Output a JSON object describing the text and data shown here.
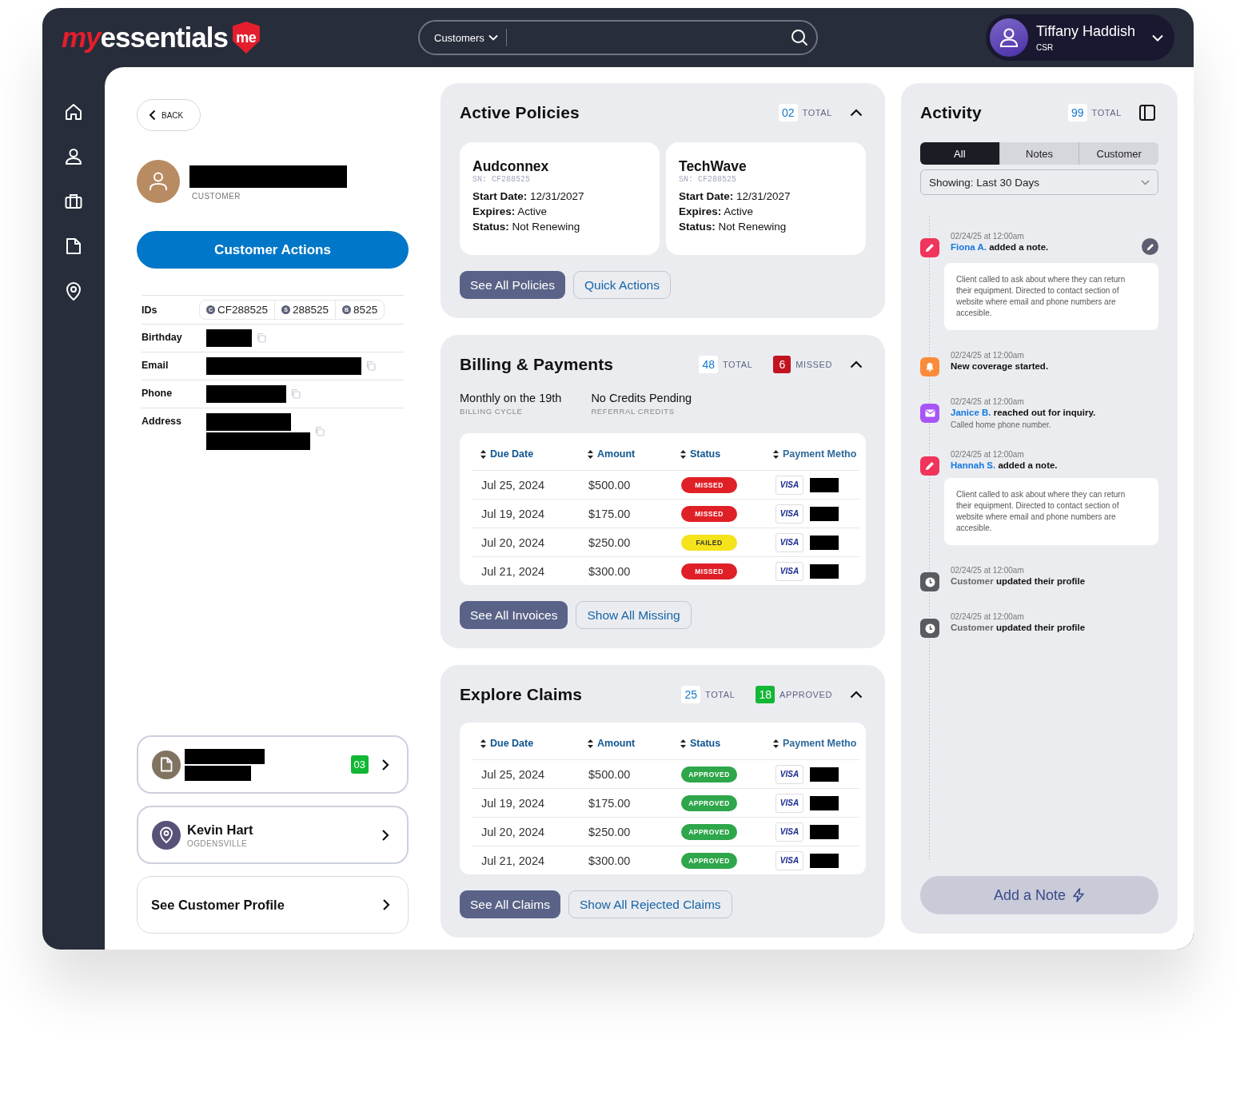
{
  "logo": {
    "prefix": "my",
    "name": "essentials",
    "badge": "me"
  },
  "search": {
    "scope": "Customers"
  },
  "user": {
    "name": "Tiffany Haddish",
    "role": "CSR"
  },
  "nav": [
    {
      "kind": "home"
    },
    {
      "kind": "person"
    },
    {
      "kind": "briefcase"
    },
    {
      "kind": "document"
    },
    {
      "kind": "pin"
    }
  ],
  "back": {
    "label": "BACK"
  },
  "customer": {
    "name_redacted": true,
    "role": "CUSTOMER"
  },
  "customer_actions": {
    "label": "Customer Actions"
  },
  "ids": {
    "label": "IDs",
    "items": [
      {
        "letter": "C",
        "value": "CF288525"
      },
      {
        "letter": "S",
        "value": "288525"
      },
      {
        "letter": "B",
        "value": "8525"
      }
    ]
  },
  "details": [
    {
      "label": "Birthday",
      "redacted": true
    },
    {
      "label": "Email",
      "redacted": true
    },
    {
      "label": "Phone",
      "redacted": true
    },
    {
      "label": "Address",
      "redacted": true
    }
  ],
  "link_cards": [
    {
      "kind": "file",
      "count": "03"
    },
    {
      "kind": "location",
      "title": "Kevin Hart",
      "subtitle": "OGDENSVILLE"
    },
    {
      "kind": "plain",
      "title": "See Customer Profile"
    }
  ],
  "policies": {
    "title": "Active Policies",
    "counts": [
      {
        "kind": "total",
        "value": "02",
        "label": "TOTAL"
      }
    ],
    "expanded": true,
    "cards": [
      {
        "name": "Audconnex",
        "sn": "SN: CF288525",
        "fields": [
          {
            "label": "Start Date:",
            "value": "12/31/2027"
          },
          {
            "label": "Expires:",
            "value": "Active"
          },
          {
            "label": "Status:",
            "value": "Not Renewing"
          }
        ]
      },
      {
        "name": "TechWave",
        "sn": "SN: CF288525",
        "fields": [
          {
            "label": "Start Date:",
            "value": "12/31/2027"
          },
          {
            "label": "Expires:",
            "value": "Active"
          },
          {
            "label": "Status:",
            "value": "Not Renewing"
          }
        ]
      }
    ],
    "buttons": [
      {
        "kind": "primary",
        "label": "See All Policies"
      },
      {
        "kind": "outline",
        "label": "Quick Actions"
      }
    ]
  },
  "billing": {
    "title": "Billing & Payments",
    "counts": [
      {
        "kind": "total",
        "value": "48",
        "label": "TOTAL"
      },
      {
        "kind": "missed",
        "value": "6",
        "label": "MISSED"
      }
    ],
    "expanded": true,
    "meta": [
      {
        "value": "Monthly on the 19th",
        "label": "BILLING CYCLE"
      },
      {
        "value": "No Credits Pending",
        "label": "REFERRAL CREDITS"
      }
    ],
    "columns": [
      "Due Date",
      "Amount",
      "Status",
      "Payment Metho"
    ],
    "rows": [
      {
        "date": "Jul 25, 2024",
        "amount": "$500.00",
        "status": {
          "kind": "missed",
          "label": "MISSED"
        },
        "card": "VISA"
      },
      {
        "date": "Jul 19, 2024",
        "amount": "$175.00",
        "status": {
          "kind": "missed",
          "label": "MISSED"
        },
        "card": "VISA"
      },
      {
        "date": "Jul 20, 2024",
        "amount": "$250.00",
        "status": {
          "kind": "failed",
          "label": "FAILED"
        },
        "card": "VISA"
      },
      {
        "date": "Jul 21, 2024",
        "amount": "$300.00",
        "status": {
          "kind": "missed",
          "label": "MISSED"
        },
        "card": "VISA"
      }
    ],
    "buttons": [
      {
        "kind": "primary",
        "label": "See All Invoices"
      },
      {
        "kind": "outline",
        "label": "Show All Missing"
      }
    ]
  },
  "claims": {
    "title": "Explore Claims",
    "counts": [
      {
        "kind": "total",
        "value": "25",
        "label": "TOTAL"
      },
      {
        "kind": "approved",
        "value": "18",
        "label": "APPROVED"
      }
    ],
    "expanded": true,
    "columns": [
      "Due Date",
      "Amount",
      "Status",
      "Payment Metho"
    ],
    "rows": [
      {
        "date": "Jul 25, 2024",
        "amount": "$500.00",
        "status": {
          "kind": "approved",
          "label": "APPROVED"
        },
        "card": "VISA"
      },
      {
        "date": "Jul 19, 2024",
        "amount": "$175.00",
        "status": {
          "kind": "approved",
          "label": "APPROVED"
        },
        "card": "VISA"
      },
      {
        "date": "Jul 20, 2024",
        "amount": "$250.00",
        "status": {
          "kind": "approved",
          "label": "APPROVED"
        },
        "card": "VISA"
      },
      {
        "date": "Jul 21, 2024",
        "amount": "$300.00",
        "status": {
          "kind": "approved",
          "label": "APPROVED"
        },
        "card": "VISA"
      }
    ],
    "buttons": [
      {
        "kind": "primary",
        "label": "See All Claims"
      },
      {
        "kind": "outline",
        "label": "Show All Rejected Claims"
      }
    ]
  },
  "activity": {
    "title": "Activity",
    "counts": [
      {
        "kind": "total",
        "value": "99",
        "label": "TOTAL"
      }
    ],
    "tabs": [
      {
        "label": "All",
        "selected": true
      },
      {
        "label": "Notes",
        "selected": false
      },
      {
        "label": "Customer",
        "selected": false
      }
    ],
    "filter": "Showing: Last 30 Days",
    "items": [
      {
        "kind": "note",
        "time": "02/24/25 at 12:00am",
        "actor": "Fiona A.",
        "action": "added a note.",
        "editable": true,
        "note": "Client called to ask about where they can return their equipment. Directed to contact section of website where email and phone numbers are accesible."
      },
      {
        "kind": "alert",
        "time": "02/24/25 at 12:00am",
        "action": "New coverage started."
      },
      {
        "kind": "mail",
        "time": "02/24/25 at 12:00am",
        "actor": "Janice B.",
        "action": "reached out for inquiry.",
        "detail": "Called home phone number."
      },
      {
        "kind": "note",
        "time": "02/24/25 at 12:00am",
        "actor": "Hannah S.",
        "action": "added a note.",
        "note": "Client called to ask about where they can return their equipment. Directed to contact section of website where email and phone numbers are accesible."
      },
      {
        "kind": "update",
        "time": "02/24/25 at 12:00am",
        "actor": "Customer",
        "action": "updated their profile"
      },
      {
        "kind": "update",
        "time": "02/24/25 at 12:00am",
        "actor": "Customer",
        "action": "updated their profile"
      }
    ],
    "add_button": "Add a Note"
  }
}
